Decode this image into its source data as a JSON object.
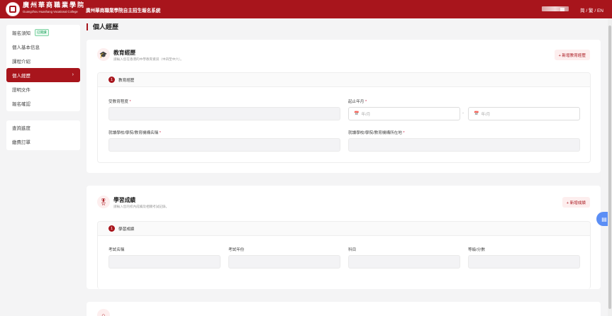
{
  "header": {
    "school_name_cn": "廣州華商職業學院",
    "school_name_en": "Guangzhou Huashang Vocational College",
    "system_title": "廣州華商職業學院自主招生報名系統",
    "language_switch": "简 / 繁 / EN"
  },
  "sidebar": {
    "group1": [
      {
        "label": "報名須知",
        "badge": "已閱讀"
      },
      {
        "label": "個人基本信息"
      },
      {
        "label": "課程介紹"
      },
      {
        "label": "個人經歷",
        "active": true,
        "chevron": "›"
      },
      {
        "label": "證明文件"
      },
      {
        "label": "報名確認"
      }
    ],
    "group2": [
      {
        "label": "查詢進度"
      },
      {
        "label": "繳費訂單"
      }
    ]
  },
  "page": {
    "title": "個人經歷"
  },
  "education": {
    "icon": "graduation-cap-icon",
    "title": "教育經歷",
    "subtitle": "請輸入您在香港的中學教育資訊（中四至中六）。",
    "add_label": "+ 新增教育經歷",
    "entry_no": "1",
    "entry_title": "教育經歷",
    "fields": {
      "level": "受教育程度",
      "period": "起止年月",
      "school_name": "就讀學校/學院/教育機構名稱",
      "school_location": "就讀學校/學院/教育機構所在地"
    },
    "required_mark": "*",
    "date_placeholder": "年/月",
    "range_separator": "-"
  },
  "academic": {
    "icon": "award-ribbon-icon",
    "title": "學習成績",
    "subtitle": "請輸入您的校內成績及相關考試記錄。",
    "add_label": "+ 新增成績",
    "entry_no": "1",
    "entry_title": "學習成績",
    "fields": {
      "exam_name": "考試名稱",
      "exam_year": "考試年份",
      "subject": "科目",
      "grade": "等級/分數"
    }
  },
  "colors": {
    "brand": "#a8151c",
    "float_button": "#5b8ef5"
  }
}
